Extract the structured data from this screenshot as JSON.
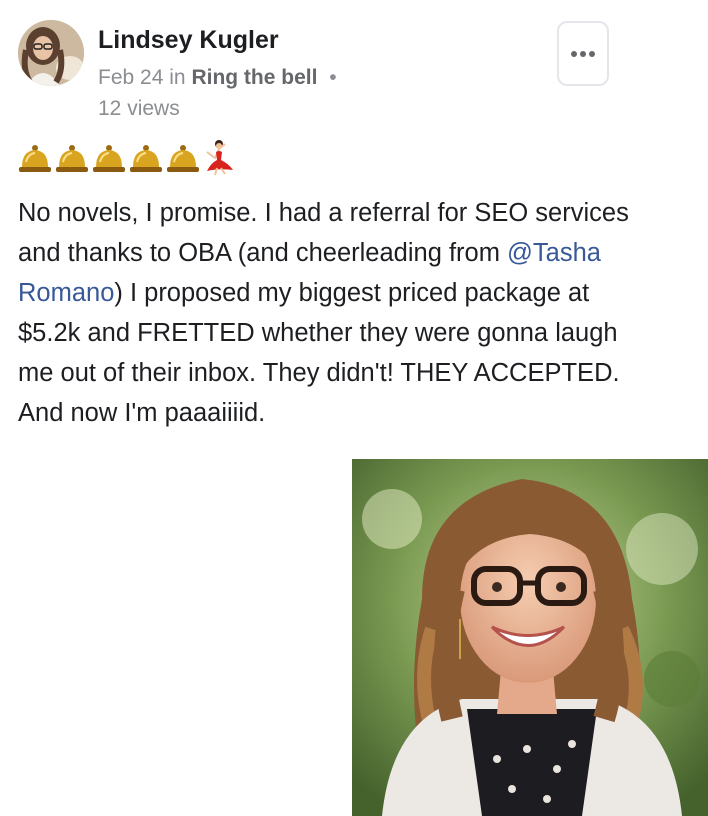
{
  "post": {
    "author_name": "Lindsey Kugler",
    "date": "Feb 24",
    "in_label": "in",
    "group_name": "Ring the bell",
    "separator": "•",
    "views": "12 views",
    "more_icon": "more-horizontal-icon",
    "emoji_icons": [
      "bell-icon",
      "bell-icon",
      "bell-icon",
      "bell-icon",
      "bell-icon",
      "dancer-icon"
    ],
    "body_before_mention": "No novels, I promise. I had a referral for SEO services and thanks to OBA (and cheerleading from ",
    "mention": "@Tasha Romano",
    "body_after_mention": ") I proposed my biggest priced package at $5.2k and FRETTED whether they were gonna laugh me out of their inbox. They didn't! THEY ACCEPTED. And now I'm paaaiiiid.",
    "colors": {
      "mention": "#385898",
      "meta": "#8a8d91",
      "group_link": "#65676b"
    }
  }
}
